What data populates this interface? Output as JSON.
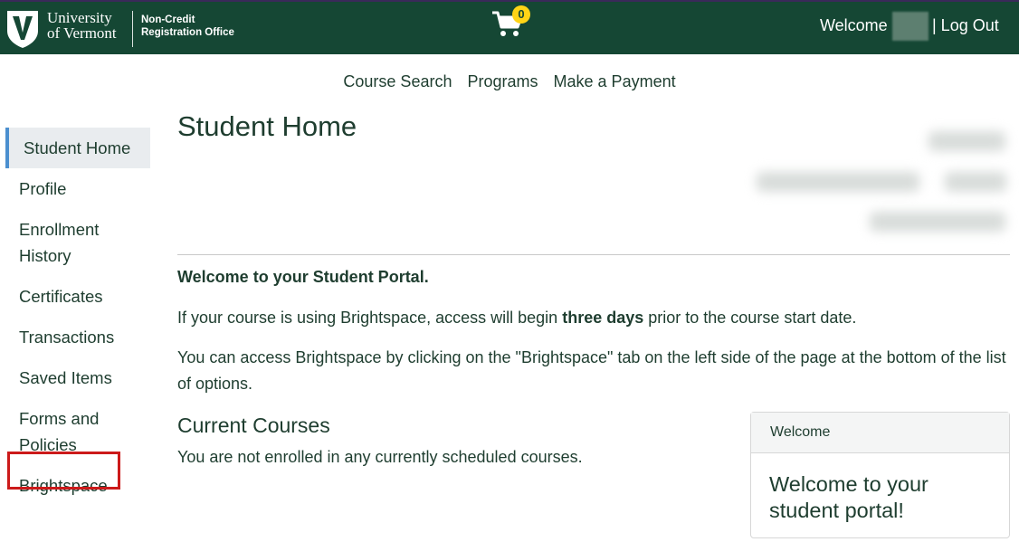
{
  "header": {
    "university_line1": "University",
    "university_line2": "of Vermont",
    "office_line1": "Non-Credit",
    "office_line2": "Registration Office",
    "cart_count": "0",
    "welcome": "Welcome",
    "logout": "| Log Out",
    "colors": {
      "bar": "#154734",
      "badge": "#ffd416"
    }
  },
  "nav": {
    "course_search": "Course Search",
    "programs": "Programs",
    "make_payment": "Make a Payment"
  },
  "sidebar": {
    "items": [
      {
        "label": "Student Home",
        "active": true
      },
      {
        "label": "Profile"
      },
      {
        "label": "Enrollment History"
      },
      {
        "label": "Certificates"
      },
      {
        "label": "Transactions"
      },
      {
        "label": "Saved Items"
      },
      {
        "label": "Forms and Policies"
      },
      {
        "label": "Brightspace",
        "highlighted": true
      }
    ]
  },
  "main": {
    "title": "Student Home",
    "intro_heading": "Welcome to your Student Portal.",
    "para1_before": "If your course is using Brightspace, access will begin ",
    "para1_bold": "three days",
    "para1_after": " prior to the course start date.",
    "para2": "You can access Brightspace by clicking on the \"Brightspace\" tab on the left side of the page at the bottom of the list of options.",
    "current_courses_title": "Current Courses",
    "current_courses_empty": "You are not enrolled in any currently scheduled courses."
  },
  "welcome_card": {
    "header": "Welcome",
    "body": "Welcome to your student portal!"
  }
}
